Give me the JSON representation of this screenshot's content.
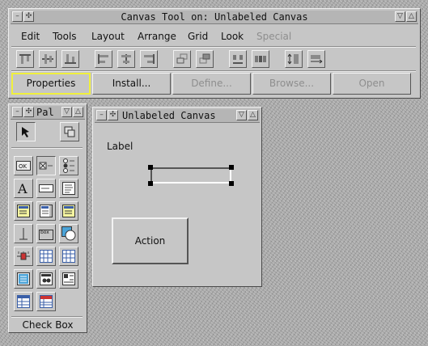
{
  "main_window": {
    "title": "Canvas Tool on: Unlabeled Canvas",
    "menus": [
      "Edit",
      "Tools",
      "Layout",
      "Arrange",
      "Grid",
      "Look",
      "Special"
    ],
    "toolbar_icons": [
      "align-tops-icon",
      "align-middles-icon",
      "align-bottoms-icon",
      "align-lefts-icon",
      "align-centers-icon",
      "align-rights-icon",
      "move-to-front-icon",
      "move-to-back-icon",
      "group-icon",
      "ungroup-icon",
      "equal-height-icon",
      "equal-width-icon"
    ],
    "action_buttons": {
      "properties": "Properties",
      "install": "Install...",
      "define": "Define...",
      "browse": "Browse...",
      "open": "Open"
    }
  },
  "palette": {
    "title": "Pal",
    "status": "Check Box",
    "tools": [
      "pointer-icon",
      "group-widget-icon",
      "button-widget-icon",
      "check-box-icon",
      "radio-button-icon",
      "label-icon",
      "input-field-icon",
      "text-editor-icon",
      "menu-button-icon",
      "list-view-icon",
      "combo-list-icon",
      "divider-icon",
      "region-icon",
      "view-holder-icon",
      "slider-icon",
      "table-icon",
      "data-set-icon",
      "notebook-icon",
      "picture-icon",
      "subcanvas-icon",
      "dataset-view-icon",
      "tab-control-icon"
    ]
  },
  "canvas_window": {
    "title": "Unlabeled Canvas",
    "label_widget": "Label",
    "action_widget": "Action"
  },
  "colors": {
    "window_bg": "#c6c6c6",
    "selected_border": "#f0f03c",
    "disabled_text": "#8e8e8e"
  }
}
